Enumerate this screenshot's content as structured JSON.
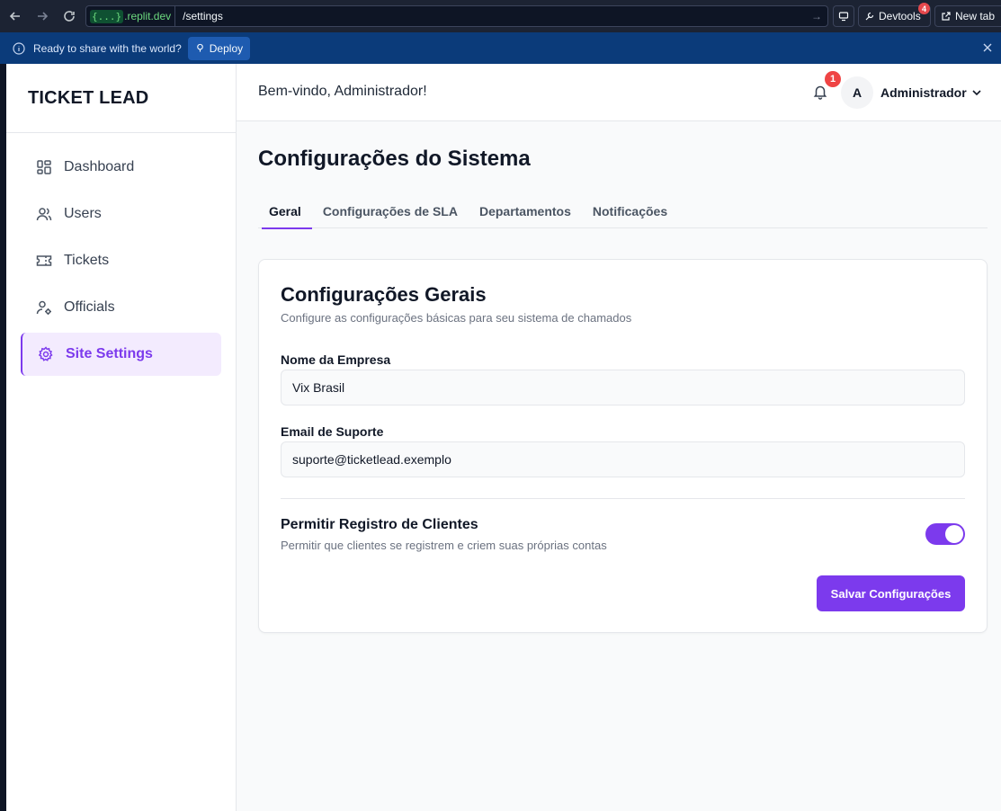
{
  "browser": {
    "url_brace": "{...}",
    "url_host": ".replit.dev",
    "url_path": "/settings",
    "devtools_label": "Devtools",
    "devtools_badge": "4",
    "newtab_label": "New tab"
  },
  "banner": {
    "text": "Ready to share with the world?",
    "deploy_label": "Deploy"
  },
  "sidebar": {
    "brand": "TICKET LEAD",
    "items": [
      {
        "label": "Dashboard",
        "icon": "dashboard-icon"
      },
      {
        "label": "Users",
        "icon": "users-icon"
      },
      {
        "label": "Tickets",
        "icon": "ticket-icon"
      },
      {
        "label": "Officials",
        "icon": "user-gear-icon"
      },
      {
        "label": "Site Settings",
        "icon": "gear-icon",
        "active": true
      }
    ]
  },
  "header": {
    "welcome": "Bem-vindo, Administrador!",
    "notification_count": "1",
    "avatar_initial": "A",
    "user_name": "Administrador"
  },
  "main": {
    "title": "Configurações do Sistema",
    "tabs": [
      {
        "label": "Geral",
        "active": true
      },
      {
        "label": "Configurações de SLA"
      },
      {
        "label": "Departamentos"
      },
      {
        "label": "Notificações"
      }
    ],
    "card": {
      "title": "Configurações Gerais",
      "description": "Configure as configurações básicas para seu sistema de chamados",
      "company_label": "Nome da Empresa",
      "company_value": "Vix Brasil",
      "email_label": "Email de Suporte",
      "email_value": "suporte@ticketlead.exemplo",
      "toggle_title": "Permitir Registro de Clientes",
      "toggle_description": "Permitir que clientes se registrem e criem suas próprias contas",
      "toggle_on": true,
      "save_label": "Salvar Configurações"
    }
  },
  "colors": {
    "accent": "#7c3aed",
    "banner": "#0b3b7a",
    "badge": "#ef4444"
  }
}
